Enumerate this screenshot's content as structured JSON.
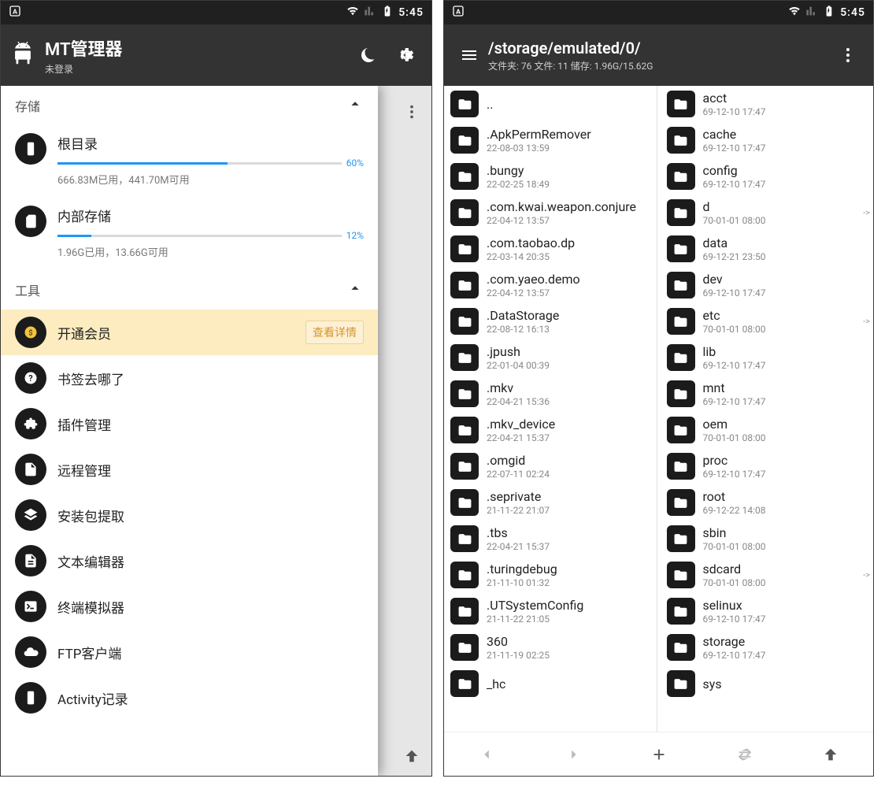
{
  "status": {
    "time": "5:45"
  },
  "left": {
    "toolbar": {
      "title": "MT管理器",
      "subtitle": "未登录"
    },
    "sections": {
      "storage_label": "存储",
      "tools_label": "工具"
    },
    "storage": [
      {
        "name": "根目录",
        "percent": 60,
        "percent_label": "60%",
        "detail": "666.83M已用，441.70M可用"
      },
      {
        "name": "内部存储",
        "percent": 12,
        "percent_label": "12%",
        "detail": "1.96G已用，13.66G可用"
      }
    ],
    "tools": [
      {
        "name": "开通会员",
        "action": "查看详情",
        "highlight": true,
        "icon": "money"
      },
      {
        "name": "书签去哪了",
        "icon": "question"
      },
      {
        "name": "插件管理",
        "icon": "puzzle"
      },
      {
        "name": "远程管理",
        "icon": "file"
      },
      {
        "name": "安装包提取",
        "icon": "layers"
      },
      {
        "name": "文本编辑器",
        "icon": "doc"
      },
      {
        "name": "终端模拟器",
        "icon": "terminal"
      },
      {
        "name": "FTP客户端",
        "icon": "cloud"
      },
      {
        "name": "Activity记录",
        "icon": "phone"
      }
    ]
  },
  "right": {
    "toolbar": {
      "path": "/storage/emulated/0/",
      "stats": "文件夹: 76  文件: 11  储存: 1.96G/15.62G"
    },
    "col1": [
      {
        "name": "..",
        "date": ""
      },
      {
        "name": ".ApkPermRemover",
        "date": "22-08-03 13:59"
      },
      {
        "name": ".bungy",
        "date": "22-02-25 18:49"
      },
      {
        "name": ".com.kwai.weapon.conjure",
        "date": "22-04-12 13:57"
      },
      {
        "name": ".com.taobao.dp",
        "date": "22-03-14 20:35"
      },
      {
        "name": ".com.yaeo.demo",
        "date": "22-04-12 13:57"
      },
      {
        "name": ".DataStorage",
        "date": "22-08-12 16:13"
      },
      {
        "name": ".jpush",
        "date": "22-01-04 00:39"
      },
      {
        "name": ".mkv",
        "date": "22-04-21 15:36"
      },
      {
        "name": ".mkv_device",
        "date": "22-04-21 15:37"
      },
      {
        "name": ".omgid",
        "date": "22-07-11 02:24"
      },
      {
        "name": ".seprivate",
        "date": "21-11-22 21:07"
      },
      {
        "name": ".tbs",
        "date": "22-04-21 15:37"
      },
      {
        "name": ".turingdebug",
        "date": "21-11-10 01:32"
      },
      {
        "name": ".UTSystemConfig",
        "date": "21-11-22 21:05"
      },
      {
        "name": "360",
        "date": "21-11-19 02:25"
      },
      {
        "name": "_hc",
        "date": ""
      }
    ],
    "col2": [
      {
        "name": "acct",
        "date": "69-12-10 17:47"
      },
      {
        "name": "cache",
        "date": "69-12-10 17:47"
      },
      {
        "name": "config",
        "date": "69-12-10 17:47"
      },
      {
        "name": "d",
        "date": "70-01-01 08:00",
        "link": true
      },
      {
        "name": "data",
        "date": "69-12-21 23:50"
      },
      {
        "name": "dev",
        "date": "69-12-10 17:47"
      },
      {
        "name": "etc",
        "date": "70-01-01 08:00",
        "link": true
      },
      {
        "name": "lib",
        "date": "69-12-10 17:47"
      },
      {
        "name": "mnt",
        "date": "69-12-10 17:47"
      },
      {
        "name": "oem",
        "date": "70-01-01 08:00"
      },
      {
        "name": "proc",
        "date": "69-12-10 17:47"
      },
      {
        "name": "root",
        "date": "69-12-22 14:08"
      },
      {
        "name": "sbin",
        "date": "70-01-01 08:00"
      },
      {
        "name": "sdcard",
        "date": "70-01-01 08:00",
        "link": true
      },
      {
        "name": "selinux",
        "date": "69-12-10 17:47"
      },
      {
        "name": "storage",
        "date": "69-12-10 17:47"
      },
      {
        "name": "sys",
        "date": ""
      }
    ]
  }
}
